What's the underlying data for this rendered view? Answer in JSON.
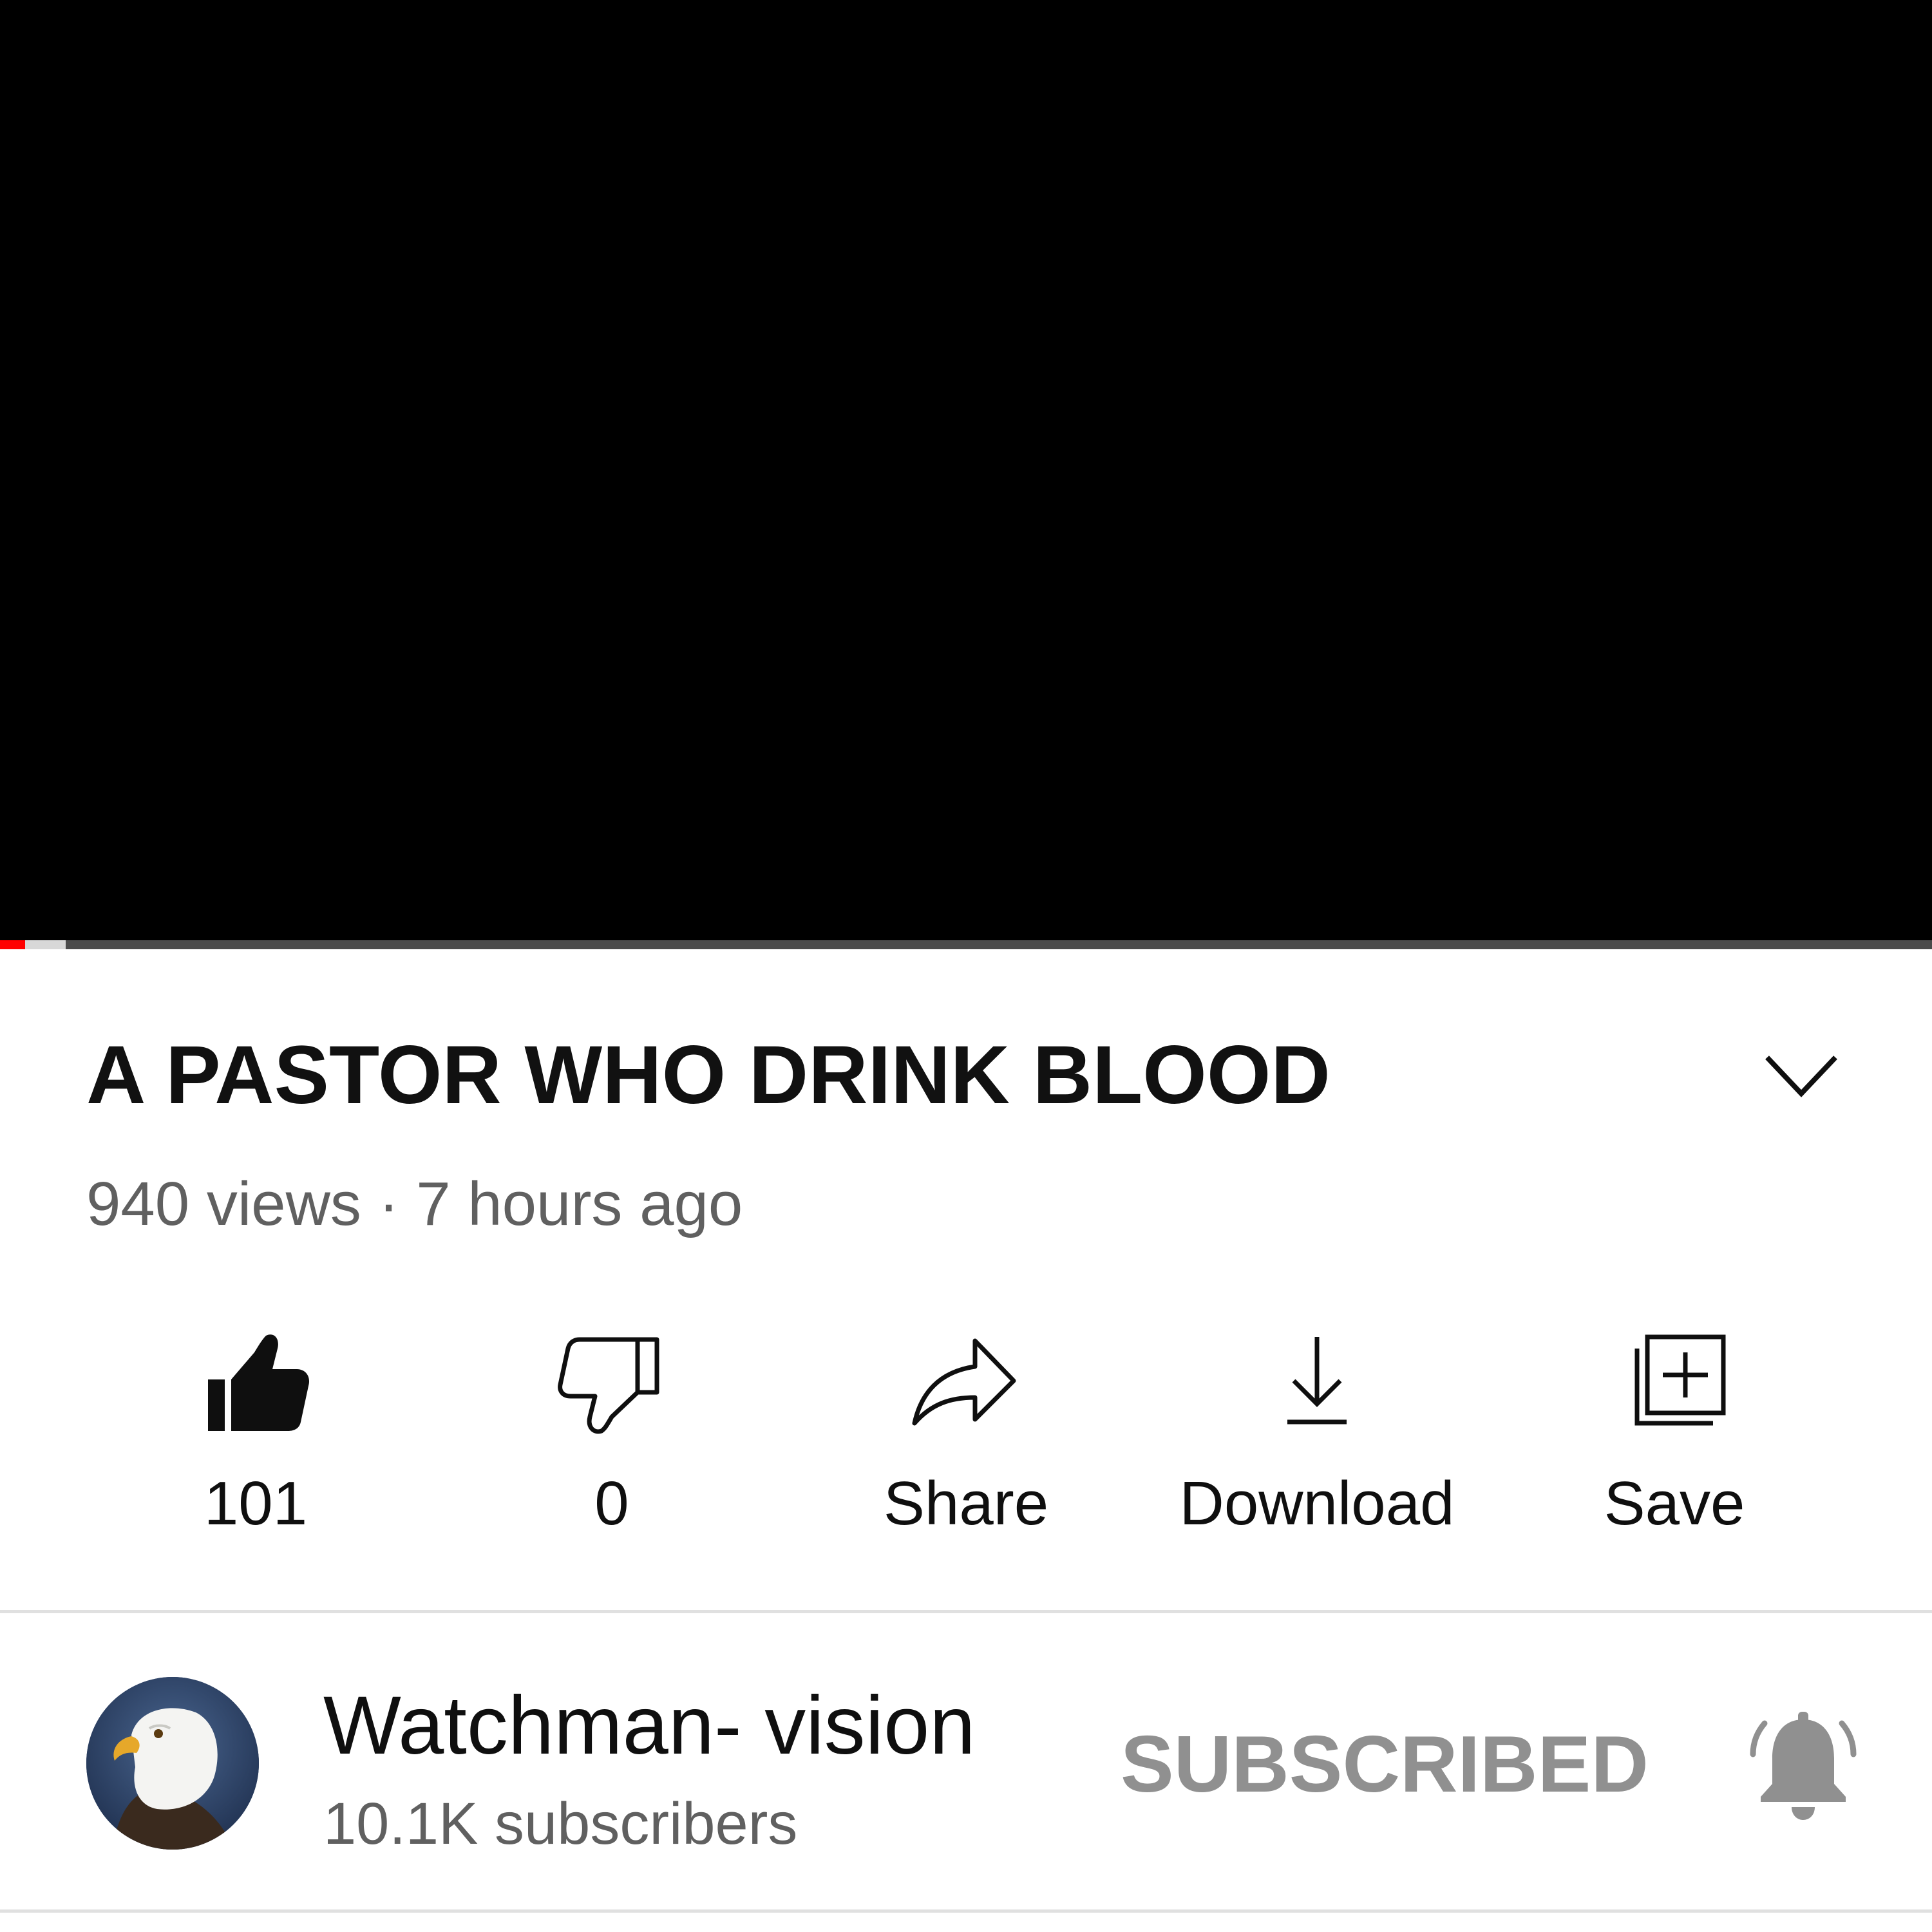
{
  "player": {
    "progress_played": 0.013,
    "progress_buffered": 0.034,
    "colors": {
      "played": "#ff0000",
      "buffered": "#d8d8d8",
      "track": "#4a4a4a"
    }
  },
  "video": {
    "title": "A PASTOR WHO DRINK BLOOD",
    "meta": "940 views · 7 hours ago",
    "expand_icon": "chevron-down-icon"
  },
  "actions": [
    {
      "label": "101",
      "icon": "thumbs-up-filled-icon"
    },
    {
      "label": "0",
      "icon": "thumbs-down-icon"
    },
    {
      "label": "Share",
      "icon": "share-icon"
    },
    {
      "label": "Download",
      "icon": "download-icon"
    },
    {
      "label": "Save",
      "icon": "save-to-playlist-icon"
    }
  ],
  "channel": {
    "name": "Watchman- vision",
    "subscribers": "10.1K subscribers",
    "subscribe_label": "SUBSCRIBED",
    "avatar": "eagle-avatar",
    "bell_icon": "notification-bell-icon"
  }
}
